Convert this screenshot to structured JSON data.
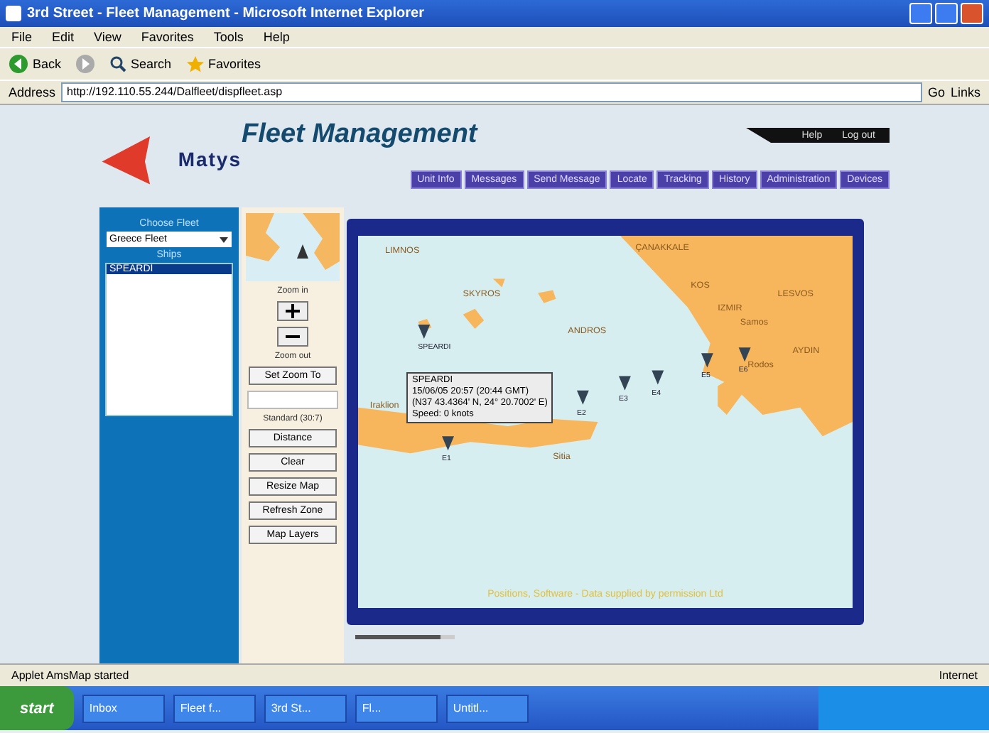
{
  "window": {
    "title": "3rd Street - Fleet Management - Microsoft Internet Explorer"
  },
  "menu": [
    "File",
    "Edit",
    "View",
    "Favorites",
    "Tools",
    "Help"
  ],
  "toolbar": [
    {
      "kind": "back",
      "label": "Back"
    },
    {
      "kind": "forward"
    },
    {
      "kind": "search",
      "label": "Search"
    },
    {
      "kind": "favorites",
      "label": "Favorites"
    }
  ],
  "address": {
    "label": "Address",
    "value": "http://192.110.55.244/Dalfleet/dispfleet.asp",
    "go": "Go",
    "links": "Links"
  },
  "header": {
    "logo": "Matys",
    "title": "Fleet Management",
    "links": [
      "Help",
      "Log out"
    ]
  },
  "nav": [
    {
      "label": "Unit Info",
      "selected": false
    },
    {
      "label": "Messages",
      "selected": false
    },
    {
      "label": "Send Message",
      "selected": false
    },
    {
      "label": "Locate",
      "selected": false
    },
    {
      "label": "Tracking",
      "selected": false
    },
    {
      "label": "History",
      "selected": false
    },
    {
      "label": "Administration",
      "selected": false
    },
    {
      "label": "Devices",
      "selected": false
    }
  ],
  "sidebar": {
    "fleet_label": "Choose Fleet",
    "fleet_value": "Greece Fleet",
    "ships_label": "Ships",
    "ships": [
      {
        "label": "SPEARDI",
        "selected": true
      }
    ]
  },
  "tools": {
    "zoom_in_label": "Zoom in",
    "zoom_out_label": "Zoom out",
    "set_zoom": "Set Zoom To",
    "scale_label": "Standard (30:7)",
    "buttons": [
      "Distance",
      "Clear",
      "Resize Map",
      "Refresh Zone",
      "Map Layers"
    ]
  },
  "map": {
    "labels": [
      "LIMNOS",
      "ÇANAKKALE",
      "SKYROS",
      "LESVOS",
      "ANDROS",
      "IZMIR",
      "Samos",
      "KOS",
      "AYDIN",
      "Rodos",
      "Iraklion",
      "Sitia"
    ],
    "ships": [
      "SPEARDI",
      "E1",
      "E2",
      "E3",
      "E4",
      "E5",
      "E6"
    ],
    "tooltip": [
      "SPEARDI",
      "15/06/05 20:57 (20:44 GMT)",
      "(N37 43.4364' N, 24° 20.7002' E)",
      "Speed: 0 knots"
    ],
    "footer": "Positions, Software - Data supplied by permission Ltd",
    "slider": {
      "level": 0.85
    }
  },
  "status_bar": {
    "text": "Applet AmsMap started",
    "zone": "Internet"
  },
  "taskbar": {
    "start": "start",
    "tasks": [
      "Inbox",
      "Fleet f...",
      "3rd St...",
      "Fl...",
      "Untitl..."
    ]
  }
}
